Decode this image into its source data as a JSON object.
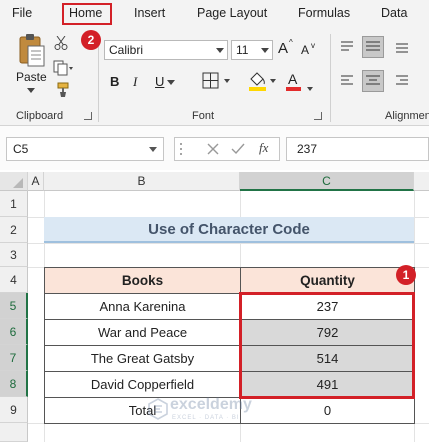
{
  "menu": {
    "file": "File",
    "home": "Home",
    "insert": "Insert",
    "page_layout": "Page Layout",
    "formulas": "Formulas",
    "data": "Data"
  },
  "badges": {
    "home_step": "2",
    "selection_step": "1"
  },
  "ribbon": {
    "clipboard": {
      "paste_label": "Paste",
      "group_label": "Clipboard"
    },
    "font": {
      "font_name": "Calibri",
      "font_size": "11",
      "group_label": "Font",
      "bold": "B",
      "italic": "I",
      "underline": "U",
      "grow": "A",
      "shrink": "A",
      "font_color_letter": "A"
    },
    "alignment": {
      "group_label": "Alignmen"
    }
  },
  "formula_bar": {
    "name_box": "C5",
    "fx": "fx",
    "formula": "237"
  },
  "grid": {
    "columns": [
      "A",
      "B",
      "C"
    ],
    "rows": [
      "1",
      "2",
      "3",
      "4",
      "5",
      "6",
      "7",
      "8",
      "9"
    ]
  },
  "sheet": {
    "title": "Use of Character Code",
    "headers": {
      "books": "Books",
      "quantity": "Quantity"
    },
    "rows": [
      {
        "book": "Anna Karenina",
        "qty": "237"
      },
      {
        "book": "War and Peace",
        "qty": "792"
      },
      {
        "book": "The Great Gatsby",
        "qty": "514"
      },
      {
        "book": "David Copperfield",
        "qty": "491"
      }
    ],
    "total": {
      "label": "Total",
      "value": "0"
    }
  },
  "watermark": {
    "name": "exceldemy",
    "tagline": "EXCEL · DATA · BI"
  },
  "colors": {
    "accent_red": "#d32027",
    "excel_green": "#217346",
    "header_fill": "#fbe4d9",
    "title_fill": "#dbe8f4",
    "selection_fill": "#d9d9d9"
  }
}
